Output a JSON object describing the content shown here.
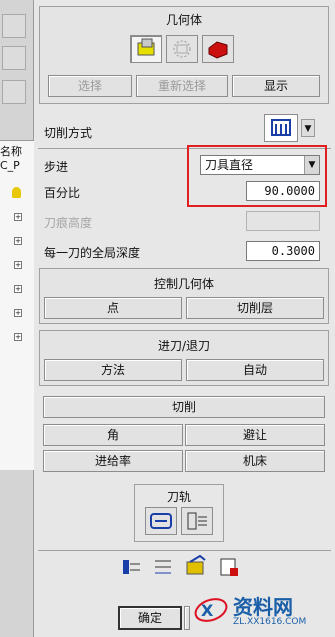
{
  "left_window": {
    "tree_label_1": "名称",
    "tree_label_2": "C_P"
  },
  "dialog": {
    "geometry_section": {
      "title": "几何体",
      "buttons": [
        "选择",
        "重新选择",
        "显示"
      ]
    },
    "cut_method": {
      "label": "切削方式"
    },
    "stepover": {
      "label": "步进",
      "value": "刀具直径",
      "red_highlight_color": "#e02020"
    },
    "percent": {
      "label": "百分比",
      "value": "90.0000"
    },
    "scallop": {
      "label": "刀痕高度"
    },
    "depth_per_cut": {
      "label": "每一刀的全局深度",
      "value": "0.3000"
    },
    "control_geometry": {
      "title": "控制几何体",
      "buttons": [
        "点",
        "切削层"
      ]
    },
    "engage_retract": {
      "title": "进刀/退刀",
      "buttons": [
        "方法",
        "自动"
      ]
    },
    "cutting_button": "切削",
    "grid_buttons": [
      "角",
      "避让",
      "进给率",
      "机床"
    ],
    "toolpath": {
      "title": "刀轨"
    },
    "ok_button": "确定"
  },
  "watermark": {
    "name": "资料网",
    "url": "ZL.XX1616.COM"
  }
}
